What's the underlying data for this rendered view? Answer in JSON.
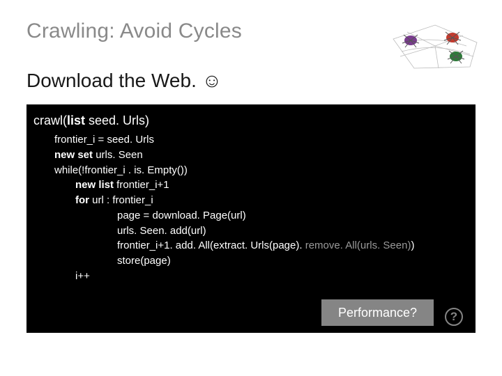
{
  "title": "Crawling: Avoid Cycles",
  "subtitle": "Download the Web. ☺",
  "code": {
    "sig_fn": "crawl(",
    "sig_kw": "list",
    "sig_arg": " seed. Urls)",
    "l1a": "frontier_i = seed. Urls",
    "l2_kw": "new set",
    "l2_rest": " urls. Seen",
    "l3a": "while(!frontier_i . is. Empty())",
    "l4_kw": "new list",
    "l4_rest": " frontier_i+1",
    "l5_kw": "for",
    "l5_rest": " url : frontier_i",
    "l6": "page = download. Page(url)",
    "l7": "urls. Seen. add(url)",
    "l8a": "frontier_i+1. add. All(extract. Urls(page).",
    "l8_gray": " remove. All(urls. Seen)",
    "l8c": ")",
    "l9": "store(page)",
    "l10": "i++"
  },
  "performance_label": "Performance?",
  "q_mark": "?"
}
